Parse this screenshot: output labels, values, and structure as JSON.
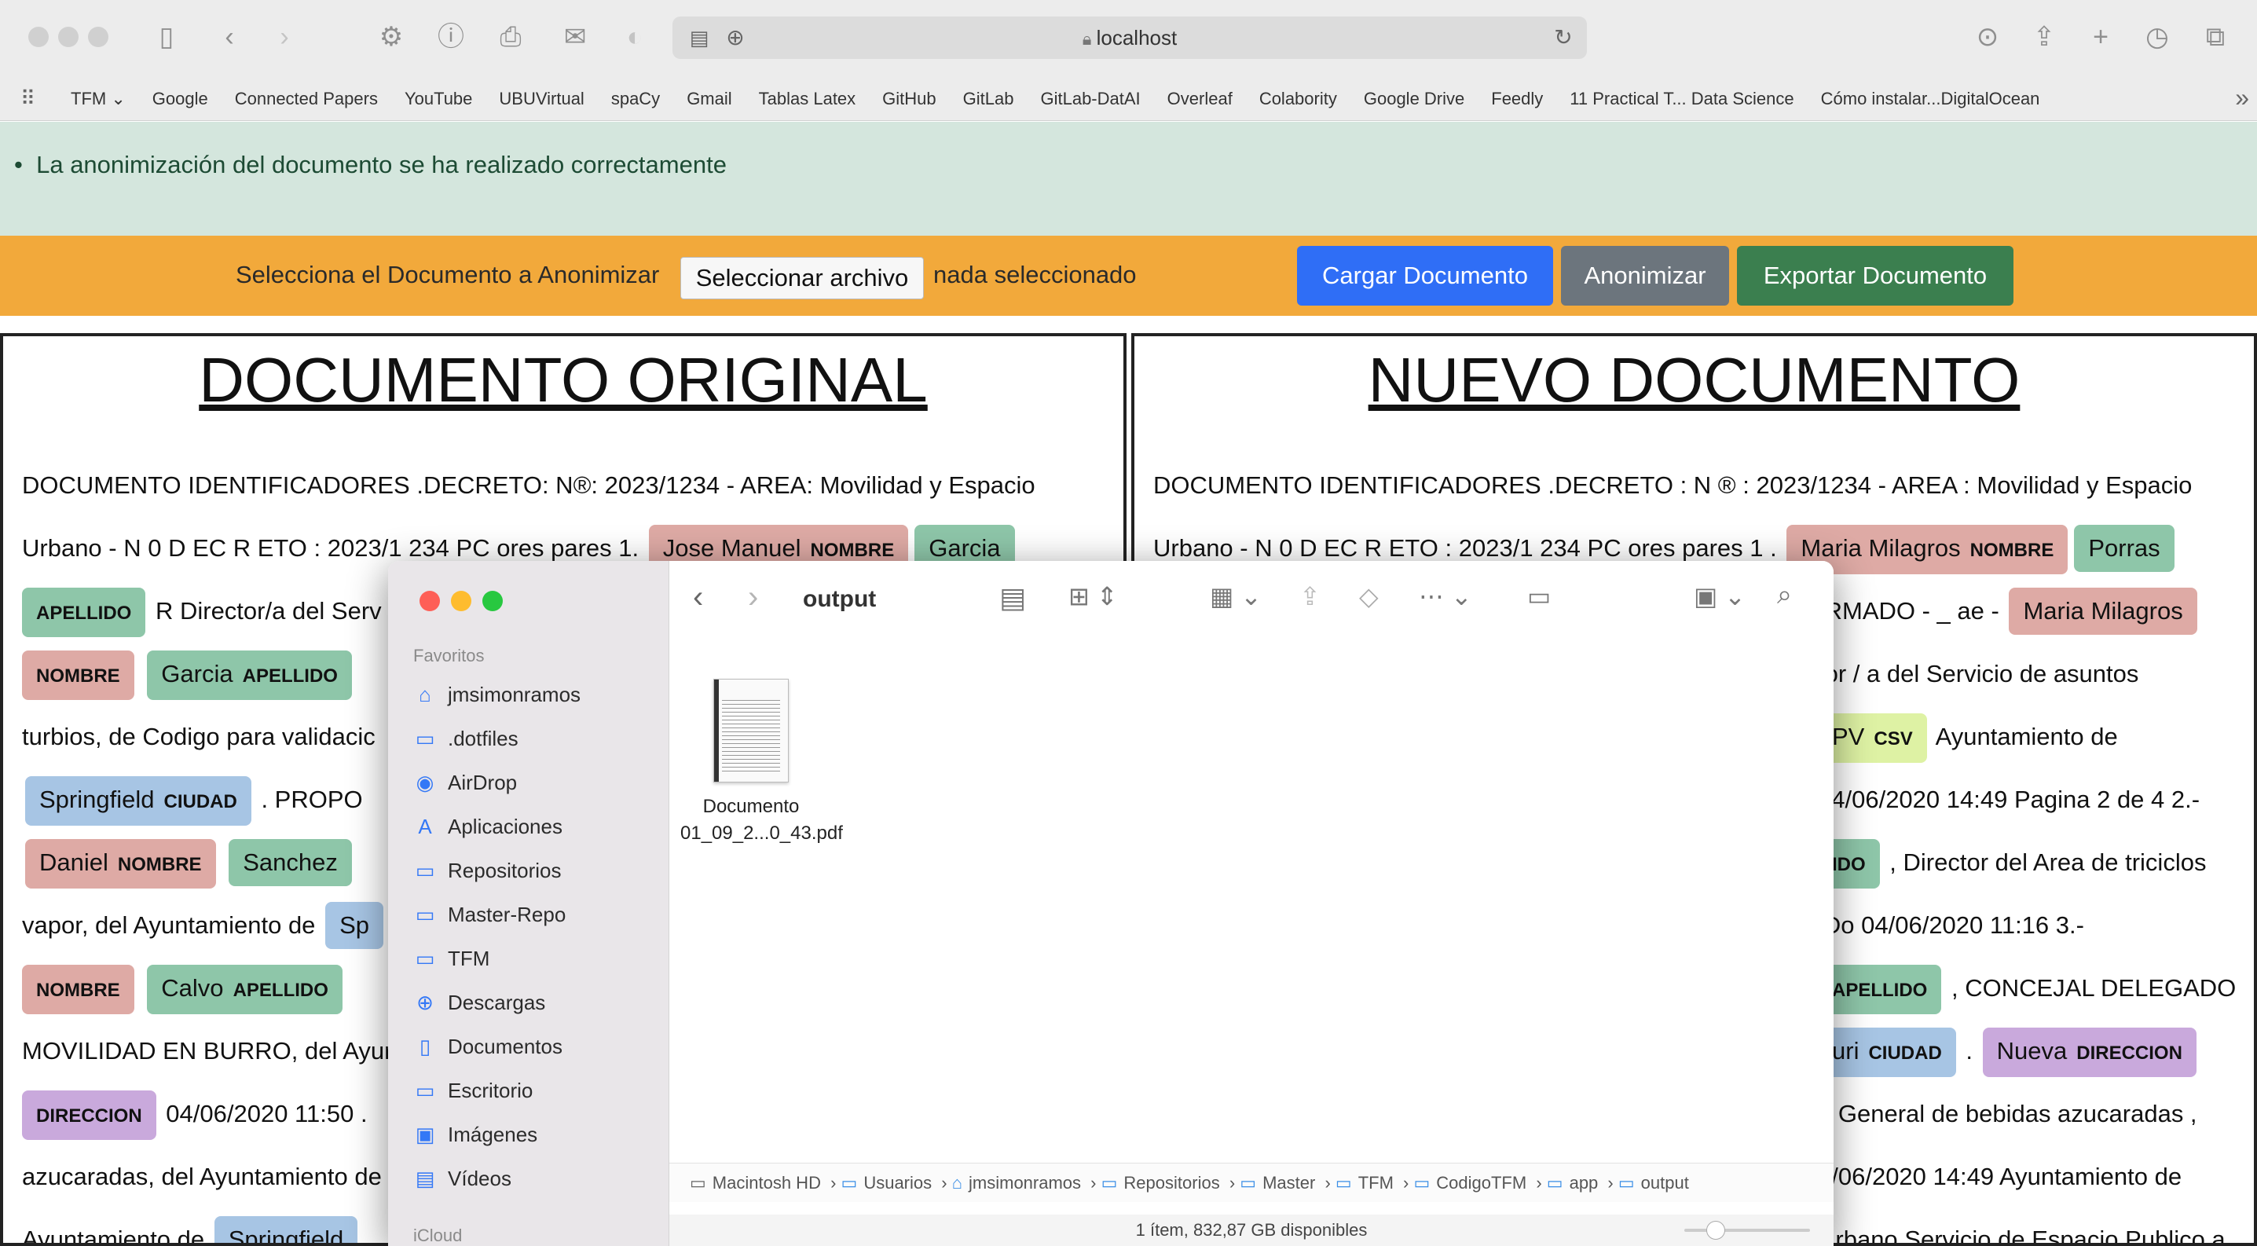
{
  "browser": {
    "url": "localhost",
    "bookmarks": [
      "TFM",
      "Google",
      "Connected Papers",
      "YouTube",
      "UBUVirtual",
      "spaCy",
      "Gmail",
      "Tablas Latex",
      "GitHub",
      "GitLab",
      "GitLab-DatAI",
      "Overleaf",
      "Colabority",
      "Google Drive",
      "Feedly",
      "11 Practical T... Data Science",
      "Cómo instalar...DigitalOcean"
    ],
    "bookmarks_tfm_chevron": "⌄",
    "more": "»"
  },
  "alert": {
    "message": "La anonimización del documento se ha realizado correctamente"
  },
  "upload": {
    "label": "Selecciona el Documento a Anonimizar",
    "file_button": "Seleccionar archivo",
    "file_status": "nada seleccionado",
    "load_button": "Cargar Documento",
    "anon_button": "Anonimizar",
    "export_button": "Exportar Documento",
    "colors": {
      "load": "#2f6ef6",
      "anon": "#6c757d",
      "export": "#3b7f4f",
      "bar": "#f2a93b"
    }
  },
  "original": {
    "title": "DOCUMENTO ORIGINAL",
    "line1": "DOCUMENTO IDENTIFICADORES .DECRETO: N®: 2023/1234 - AREA: Movilidad y Espacio",
    "line2": "Urbano - N 0 D EC R ETO : 2023/1 234 PC ores pares 1.",
    "ent1": "Jose Manuel",
    "ent1_type": "NOMBRE",
    "ent2": "Garcia",
    "line3_label": "APELLIDO",
    "line3": "R Director/a del Serv",
    "line4_label": "NOMBRE",
    "ent4": "Garcia",
    "ent4_type": "APELLIDO",
    "line5": "turbios, de Codigo para validacic",
    "ent6": "Springfield",
    "ent6_type": "CIUDAD",
    "line6": ". PROPO",
    "ent7": "Daniel",
    "ent7_type": "NOMBRE",
    "ent8": "Sanchez",
    "line8": "vapor, del Ayuntamiento de",
    "ent9": "Sp",
    "line9_label": "NOMBRE",
    "ent10": "Calvo",
    "ent10_type": "APELLIDO",
    "line10": "MOVILIDAD EN BURRO, del Ayur",
    "line11_label": "DIRECCION",
    "line11": "04/06/2020 11:50 .",
    "line12": "azucaradas, del Ayuntamiento de",
    "line13": "Ayuntamiento de",
    "ent13": "Springfield"
  },
  "nuevo": {
    "title": "NUEVO DOCUMENTO",
    "line1": "DOCUMENTO IDENTIFICADORES .DECRETO : N ® : 2023/1234 - AREA : Movilidad y Espacio",
    "line2": "Urbano - N 0 D EC R ETO : 2023/1 234 PC ores pares 1 .",
    "ent1": "Maria Milagros",
    "ent1_type": "NOMBRE",
    "ent2": "Porras",
    "line3": "IRMADO - _ ae -",
    "ent3": "Maria Milagros",
    "line4": "tor / a del Servicio de asuntos",
    "ent5": "PV",
    "ent5_type": "CSV",
    "line5": "Ayuntamiento de",
    "line6": "04/06/2020 14:49 Pagina 2 de 4 2.-",
    "line7_label": "IDO",
    "line7": ", Director del Area de triciclos",
    "line8": "iDo 04/06/2020 11:16 3.-",
    "line9_label": "APELLIDO",
    "line9": ", CONCEJAL DELEGADO",
    "ent10": "uri",
    "ent10_type": "CIUDAD",
    "ent11": "Nueva",
    "ent11_type": "DIRECCION",
    "line11": "o General de bebidas azucaradas ,",
    "line12": "4/06/2020 14:49 Ayuntamiento de",
    "line13": "Urbano Servicio de Espacio Publico a"
  },
  "finder": {
    "folder": "output",
    "favorites_label": "Favoritos",
    "icloud_label": "iCloud",
    "sidebar": [
      {
        "label": "jmsimonramos",
        "icon": "⌂"
      },
      {
        "label": ".dotfiles",
        "icon": "▭"
      },
      {
        "label": "AirDrop",
        "icon": "◉"
      },
      {
        "label": "Aplicaciones",
        "icon": "A"
      },
      {
        "label": "Repositorios",
        "icon": "▭"
      },
      {
        "label": "Master-Repo",
        "icon": "▭"
      },
      {
        "label": "TFM",
        "icon": "▭"
      },
      {
        "label": "Descargas",
        "icon": "⊕"
      },
      {
        "label": "Documentos",
        "icon": "▯"
      },
      {
        "label": "Escritorio",
        "icon": "▭"
      },
      {
        "label": "Imágenes",
        "icon": "▣"
      },
      {
        "label": "Vídeos",
        "icon": "▤"
      }
    ],
    "file_name_line1": "Documento",
    "file_name_line2": "01_09_2...0_43.pdf",
    "path": [
      "Macintosh HD",
      "Usuarios",
      "jmsimonramos",
      "Repositorios",
      "Master",
      "TFM",
      "CodigoTFM",
      "app",
      "output"
    ],
    "path_sep": "›",
    "status": "1 ítem, 832,87 GB disponibles"
  }
}
